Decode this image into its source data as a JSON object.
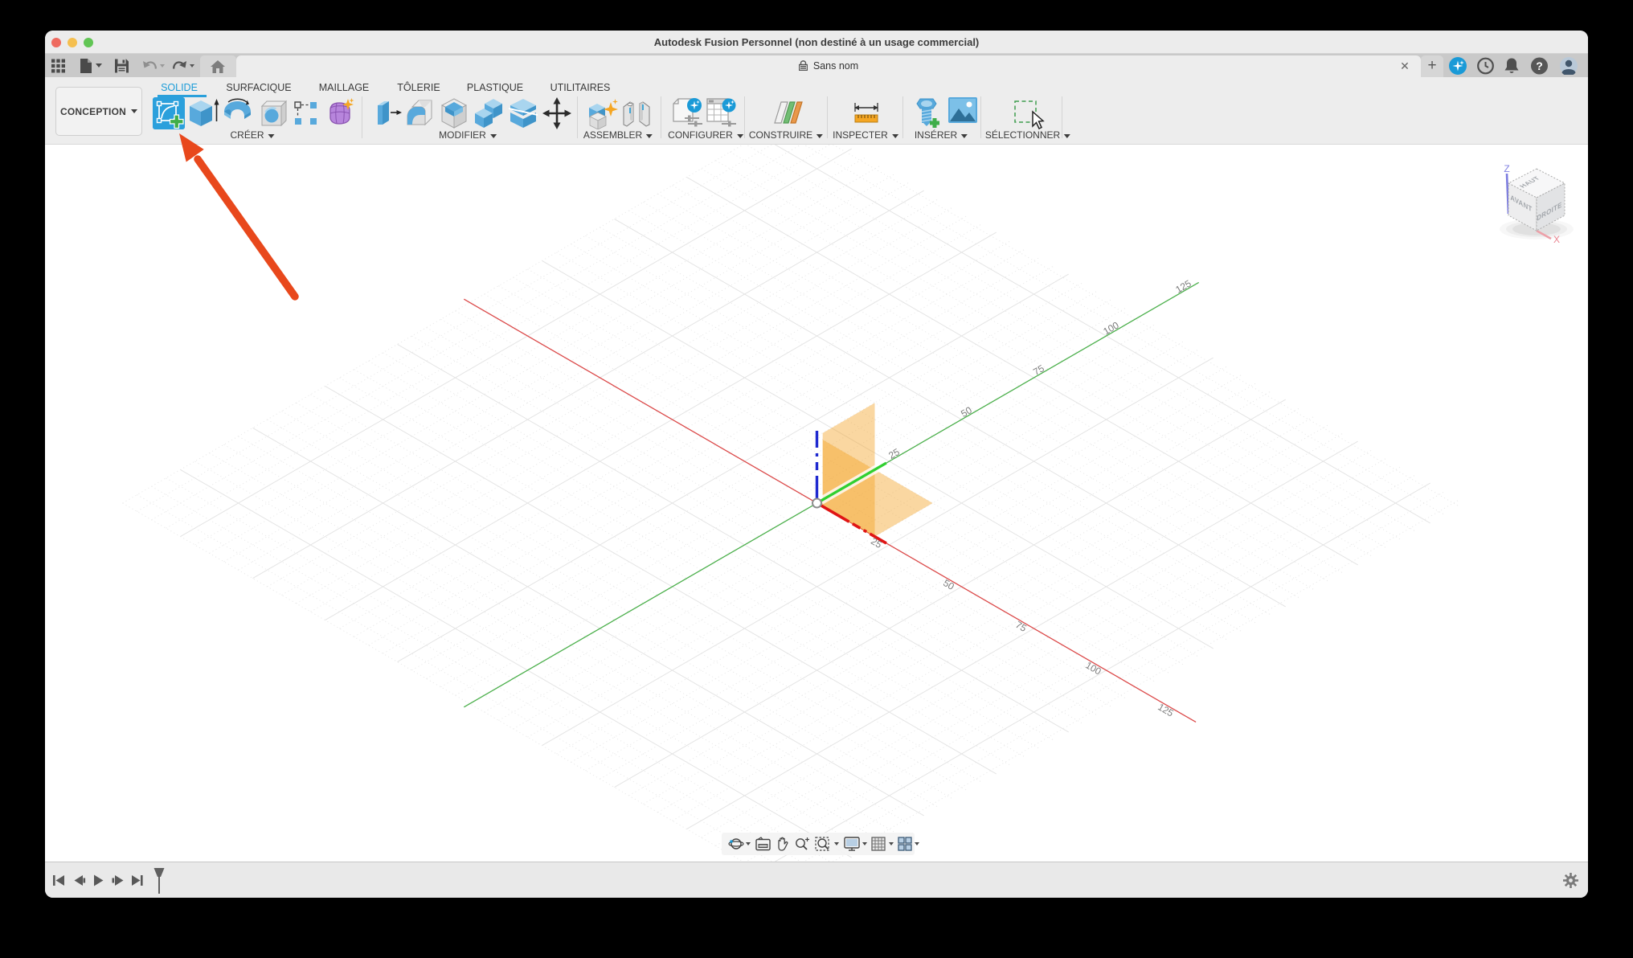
{
  "colors": {
    "accent_blue": "#1b9cd8",
    "annotation_arrow": "#e8481c",
    "axis_red": "#dc4a4a",
    "axis_green": "#4cb04c",
    "axis_z_blue": "#1f2ad0",
    "origin_plane_orange": "#f2a020"
  },
  "titlebar": {
    "title": "Autodesk Fusion Personnel (non destiné à un usage commercial)"
  },
  "document_tabs": {
    "active_tab": {
      "label": "Sans nom"
    },
    "close_label": "✕",
    "new_tab_label": "+"
  },
  "ribbon": {
    "environment_label": "CONCEPTION",
    "tabs": [
      {
        "label": "SOLIDE",
        "active": true
      },
      {
        "label": "SURFACIQUE",
        "active": false
      },
      {
        "label": "MAILLAGE",
        "active": false
      },
      {
        "label": "TÔLERIE",
        "active": false
      },
      {
        "label": "PLASTIQUE",
        "active": false
      },
      {
        "label": "UTILITAIRES",
        "active": false
      }
    ],
    "groups": [
      {
        "label": "CRÉER"
      },
      {
        "label": "MODIFIER"
      },
      {
        "label": "ASSEMBLER"
      },
      {
        "label": "CONFIGURER"
      },
      {
        "label": "CONSTRUIRE"
      },
      {
        "label": "INSPECTER"
      },
      {
        "label": "INSÉRER"
      },
      {
        "label": "SÉLECTIONNER"
      }
    ]
  },
  "viewport": {
    "axis_ticks": [
      "25",
      "50",
      "75",
      "100",
      "125"
    ],
    "viewcube": {
      "top": "HAUT",
      "front": "AVANT",
      "right": "DROITE",
      "z_label": "Z",
      "x_label": "X"
    }
  }
}
